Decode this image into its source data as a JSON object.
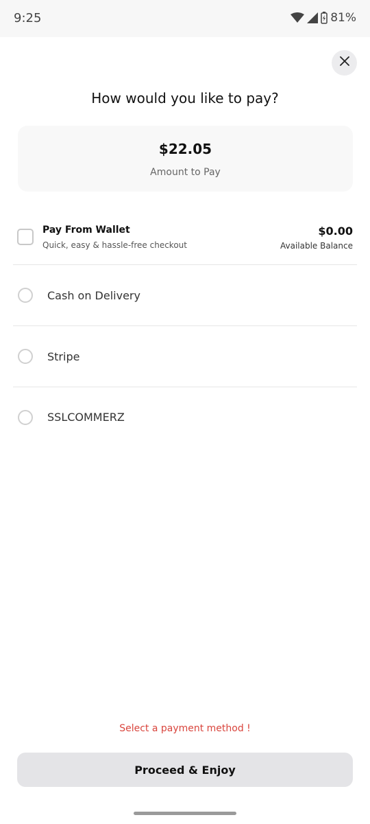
{
  "status_bar": {
    "time": "9:25",
    "battery": "81%",
    "icons": [
      "wifi-icon",
      "cell-signal-icon",
      "battery-charging-icon"
    ]
  },
  "sheet": {
    "close_icon": "close-icon",
    "title": "How would you like to pay?"
  },
  "amount": {
    "value": "$22.05",
    "label": "Amount to Pay"
  },
  "wallet": {
    "title": "Pay From Wallet",
    "subtitle": "Quick, easy & hassle-free checkout",
    "balance": "$0.00",
    "balance_label": "Available Balance",
    "checked": false
  },
  "methods": [
    {
      "label": "Cash on Delivery",
      "selected": false
    },
    {
      "label": "Stripe",
      "selected": false
    },
    {
      "label": "SSLCOMMERZ",
      "selected": false
    }
  ],
  "error_message": "Select a payment method !",
  "proceed_button": "Proceed & Enjoy",
  "colors": {
    "error": "#d9453d",
    "button_bg": "#e4e4e7",
    "card_bg": "#f8f8f8"
  }
}
